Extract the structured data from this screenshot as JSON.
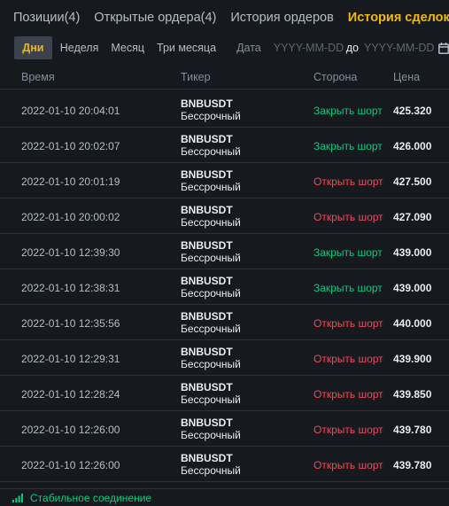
{
  "tabs": [
    {
      "label": "Позиции(4)",
      "active": false
    },
    {
      "label": "Открытые ордера(4)",
      "active": false
    },
    {
      "label": "История ордеров",
      "active": false
    },
    {
      "label": "История сделок",
      "active": true
    }
  ],
  "filters": {
    "periods": [
      "Дни",
      "Неделя",
      "Месяц",
      "Три месяца"
    ],
    "active_period": "Дни",
    "date_label": "Дата",
    "from_placeholder": "YYYY-MM-DD",
    "to_label": "до",
    "to_placeholder": "YYYY-MM-DD",
    "calendar_icon": "calendar-icon"
  },
  "table": {
    "headers": {
      "time": "Время",
      "ticker": "Тикер",
      "side": "Сторона",
      "price": "Цена"
    },
    "rows": [
      {
        "time": "2022-01-10 20:04:01",
        "ticker": "BNBUSDT",
        "type": "Бессрочный",
        "side": "Закрыть шорт",
        "price": "425.320"
      },
      {
        "time": "2022-01-10 20:02:07",
        "ticker": "BNBUSDT",
        "type": "Бессрочный",
        "side": "Закрыть шорт",
        "price": "426.000"
      },
      {
        "time": "2022-01-10 20:01:19",
        "ticker": "BNBUSDT",
        "type": "Бессрочный",
        "side": "Открыть шорт",
        "price": "427.500"
      },
      {
        "time": "2022-01-10 20:00:02",
        "ticker": "BNBUSDT",
        "type": "Бессрочный",
        "side": "Открыть шорт",
        "price": "427.090"
      },
      {
        "time": "2022-01-10 12:39:30",
        "ticker": "BNBUSDT",
        "type": "Бессрочный",
        "side": "Закрыть шорт",
        "price": "439.000"
      },
      {
        "time": "2022-01-10 12:38:31",
        "ticker": "BNBUSDT",
        "type": "Бессрочный",
        "side": "Закрыть шорт",
        "price": "439.000"
      },
      {
        "time": "2022-01-10 12:35:56",
        "ticker": "BNBUSDT",
        "type": "Бессрочный",
        "side": "Открыть шорт",
        "price": "440.000"
      },
      {
        "time": "2022-01-10 12:29:31",
        "ticker": "BNBUSDT",
        "type": "Бессрочный",
        "side": "Открыть шорт",
        "price": "439.900"
      },
      {
        "time": "2022-01-10 12:28:24",
        "ticker": "BNBUSDT",
        "type": "Бессрочный",
        "side": "Открыть шорт",
        "price": "439.850"
      },
      {
        "time": "2022-01-10 12:26:00",
        "ticker": "BNBUSDT",
        "type": "Бессрочный",
        "side": "Открыть шорт",
        "price": "439.780"
      },
      {
        "time": "2022-01-10 12:26:00",
        "ticker": "BNBUSDT",
        "type": "Бессрочный",
        "side": "Открыть шорт",
        "price": "439.780"
      }
    ]
  },
  "status": {
    "text": "Стабильное соединение",
    "icon": "signal-icon"
  },
  "colors": {
    "background": "#161a1e",
    "accent": "#f0b90b",
    "buy_green": "#0ecb81",
    "sell_red": "#f6465d",
    "divider": "#2b3139"
  }
}
